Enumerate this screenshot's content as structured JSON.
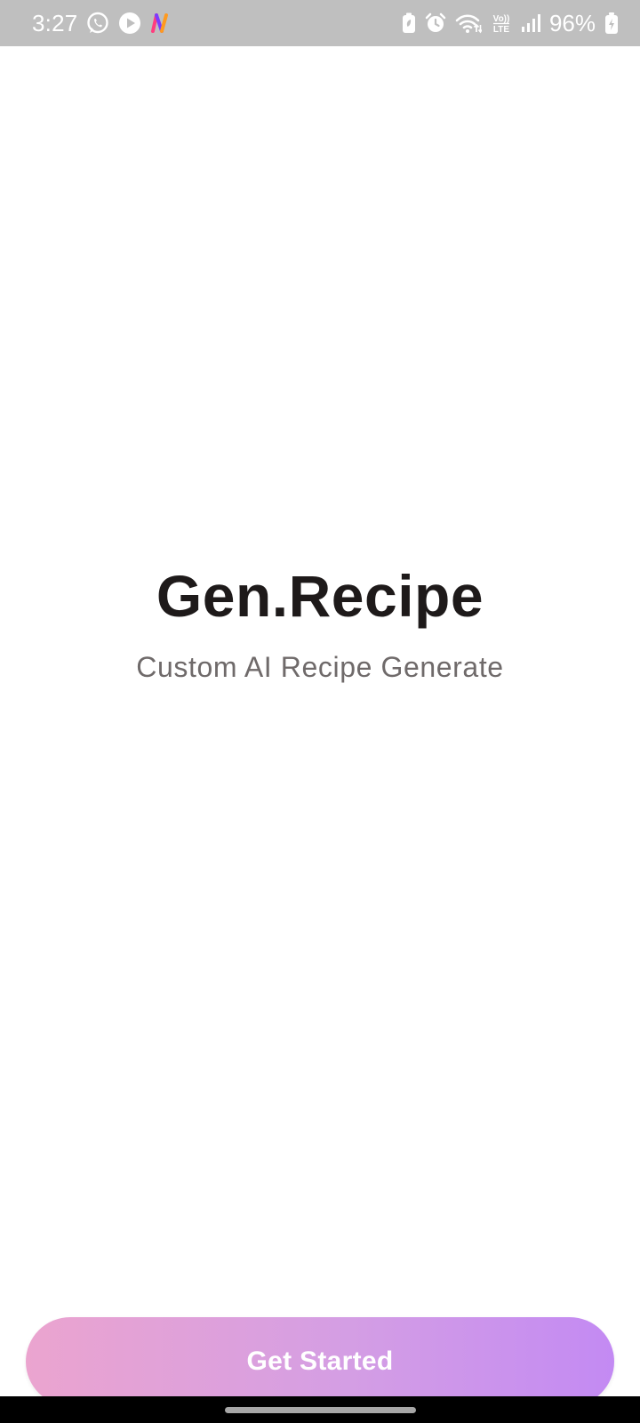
{
  "status_bar": {
    "time": "3:27",
    "battery_percent": "96%",
    "left_icons": [
      "whatsapp-icon",
      "play-icon",
      "app-n-icon"
    ],
    "right_icons": [
      "battery-saver-icon",
      "alarm-icon",
      "wifi-icon",
      "volte-icon",
      "signal-icon",
      "battery-charging-icon"
    ],
    "background_color": "#bfbfbf"
  },
  "splash": {
    "title": "Gen.Recipe",
    "subtitle": "Custom AI Recipe Generate"
  },
  "cta": {
    "label": "Get Started",
    "gradient_start": "#eba4cf",
    "gradient_end": "#c38af3"
  },
  "nav_bar": {
    "background_color": "#000000",
    "handle_color": "#a7a7a7"
  }
}
